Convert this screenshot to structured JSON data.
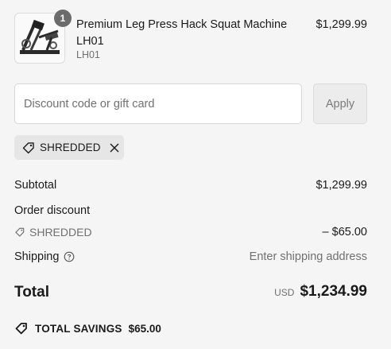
{
  "product": {
    "quantity": "1",
    "name": "Premium Leg Press Hack Squat Machine LH01",
    "variant": "LH01",
    "price": "$1,299.99",
    "image_icon": "leg-press-machine-image"
  },
  "discount": {
    "placeholder": "Discount code or gift card",
    "value": "",
    "apply_label": "Apply",
    "applied_code": "SHREDDED",
    "tag_icon": "tag-icon",
    "remove_icon": "close-icon"
  },
  "summary": {
    "subtotal_label": "Subtotal",
    "subtotal_value": "$1,299.99",
    "order_discount_label": "Order discount",
    "discount_code": "SHREDDED",
    "discount_value": "– $65.00",
    "shipping_label": "Shipping",
    "shipping_value": "Enter shipping address",
    "help_icon": "help-circle-icon"
  },
  "total": {
    "label": "Total",
    "currency": "USD",
    "amount": "$1,234.99"
  },
  "savings": {
    "label": "TOTAL SAVINGS",
    "amount": "$65.00"
  },
  "colors": {
    "background": "#f5f5f5",
    "text": "#1a1a1a",
    "muted": "#707070",
    "badge": "#6b6b6b",
    "chip": "#e6e6e6"
  }
}
